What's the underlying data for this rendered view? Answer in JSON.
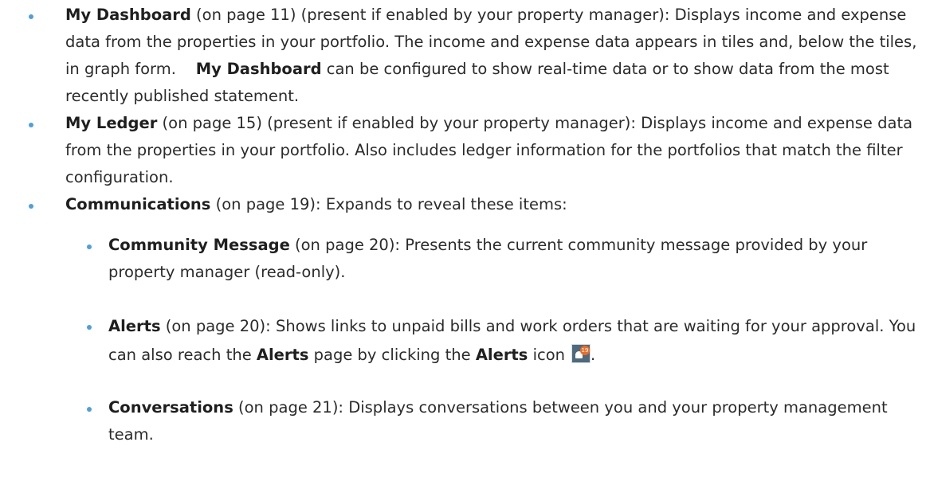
{
  "items": [
    {
      "title": "My Dashboard",
      "page_ref": "(on page 11)",
      "qualifier": "(present if enabled by your property manager):",
      "desc_1": "Displays income and expense data from the properties in your portfolio. The income and expense data appears in tiles and, below the tiles, in graph form.",
      "bold_2": "My Dashboard",
      "desc_2": "can be configured to show real-time data or to show data from the most recently published statement."
    },
    {
      "title": "My Ledger",
      "page_ref": "(on page 15)",
      "qualifier": "(present if enabled by your property manager):",
      "desc": "Displays income and expense data from the properties in your portfolio. Also includes ledger information for the portfolios that match the filter configuration."
    },
    {
      "title": "Communications",
      "page_ref": "(on page 19):",
      "desc": "Expands to reveal these items:"
    }
  ],
  "subitems": [
    {
      "title": "Community Message",
      "page_ref": "(on page 20):",
      "desc": "Presents the current community message provided by your property manager (read-only)."
    },
    {
      "title": "Alerts",
      "page_ref": "(on page 20):",
      "desc_1": "Shows links to unpaid bills and work orders that are waiting for your approval. You can also reach the",
      "bold_1": "Alerts",
      "desc_2": "page by clicking the",
      "bold_2": "Alerts",
      "desc_3": "icon",
      "icon_badge": "19",
      "end": "."
    },
    {
      "title": "Conversations",
      "page_ref": "(on page 21):",
      "desc": "Displays conversations between you and your property management team."
    }
  ],
  "colors": {
    "bullet": "#4ba0e0",
    "text": "#2b2b2b",
    "icon_bg": "#4d6a7e",
    "icon_badge": "#f26b21"
  }
}
